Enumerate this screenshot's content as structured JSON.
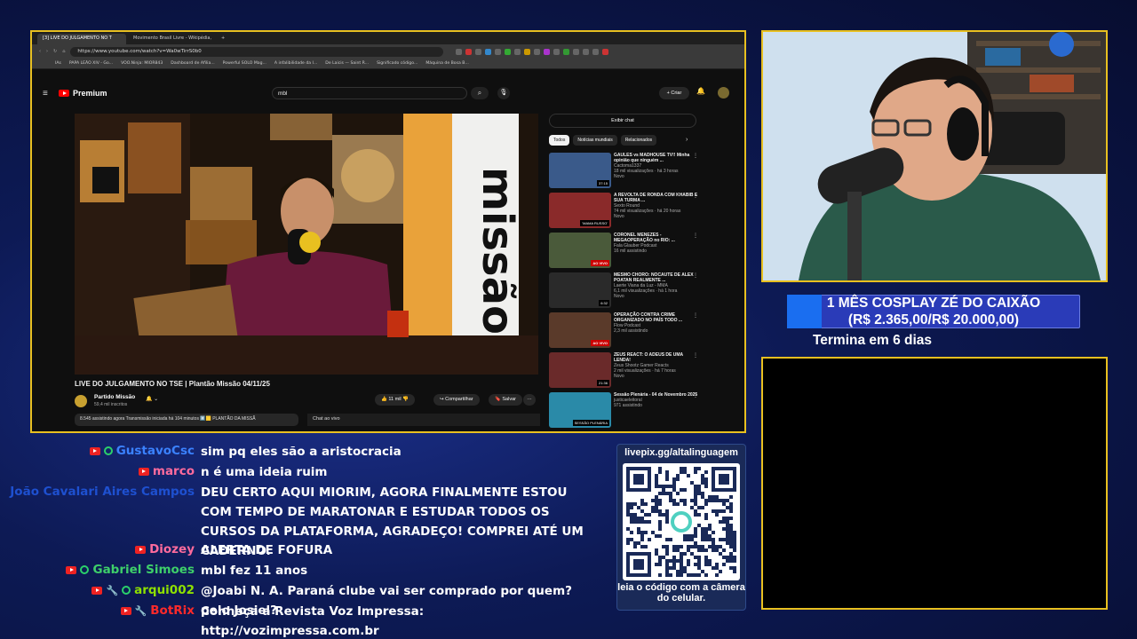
{
  "browser": {
    "tabs": [
      "[3] LIVE DO JULGAMENTO NO T",
      "Movimento Brasil Livre - Wikipédia,"
    ],
    "tab_add": "+",
    "url": "https://www.youtube.com/watch?v=Wa0wTirrS0b0",
    "bookmarks": [
      "IAs",
      "PAPA LEÃO XIV - Go...",
      "VOO.Ninja: MIOR843",
      "Dashboard de Afilia...",
      "Powerful SOLO Mag...",
      "A infalibilidade da I...",
      "De Laicis — Saint R...",
      "Significado código...",
      "Máquina de Bosa B..."
    ]
  },
  "youtube": {
    "logo": "Premium",
    "search_value": "mbl",
    "create": "+ Criar",
    "video_title": "LIVE DO JULGAMENTO NO TSE | Plantão Missão 04/11/25",
    "channel": "Partido Missão",
    "subscribers": "59,4 mil inscritos",
    "likes": "11 mil",
    "share": "Compartilhar",
    "save": "Salvar",
    "more": "···",
    "description": "8.545 assistindo agora  Transmissão iniciada há 104 minutos  #️⃣🟨 PLANTÃO DA MISSÃ",
    "chat_label": "Chat ao vivo",
    "show_chat": "Exibir chat",
    "chips": [
      "Todos",
      "Notícias mundiais",
      "Relacionados"
    ],
    "recommendations": [
      {
        "title": "GAULES vs MADHOUSE TV!! Minha opinião que ninguém ...",
        "channel": "Cactoma1337",
        "meta": "18 mil visualizações · há 3 horas",
        "badge": "Novo",
        "overlay": "37:15",
        "color": "#3a5a8a"
      },
      {
        "title": "A REVOLTA DE RONDA COM KHABIB E SUA TURMA ...",
        "channel": "Sexto Round",
        "meta": "74 mil visualizações · há 20 horas",
        "badge": "Novo",
        "overlay": "'MAMA RUSSO'",
        "color": "#8a2a2a"
      },
      {
        "title": "CORONEL MENEZES - MEGAOPERAÇÃO no RIO: ...",
        "channel": "Fala Glauber Podcast",
        "meta": "16 mil assistindo",
        "badge": "",
        "overlay": "AO VIVO",
        "color": "#4a5a3a"
      },
      {
        "title": "MESMO CHORO: NOCAUTE DE ALEX POATAN REALMENTE ...",
        "channel": "Laerte Viana da Luz - MMA",
        "meta": "6,1 mil visualizações · há 1 hora",
        "badge": "Novo",
        "overlay": "6:32",
        "color": "#2a2a2a"
      },
      {
        "title": "OPERAÇÃO CONTRA CRIME ORGANIZADO NO PAÍS TODO ...",
        "channel": "Flow Podcast",
        "meta": "2,3 mil assistindo",
        "badge": "",
        "overlay": "AO VIVO",
        "color": "#5a3a2a"
      },
      {
        "title": "ZEUS REACT: O ADEUS DE UMA LENDA!",
        "channel": "Zeus Shootz Gamer Reacts",
        "meta": "2 mil visualizações · há 7 horas",
        "badge": "Novo",
        "overlay": "21:36",
        "color": "#6a2a2a"
      },
      {
        "title": "Sessão Plenária - 04 de Novembro 2025",
        "channel": "justicaeleitoral",
        "meta": "971 assistindo",
        "badge": "",
        "overlay": "SESSÃO PLENÁRIA",
        "color": "#2a8aa8"
      }
    ]
  },
  "goal": {
    "line1": "1 MÊS COSPLAY ZÉ DO CAIXÃO",
    "line2": "(R$ 2.365,00/R$ 20.000,00)",
    "ends": "Termina em 6 dias",
    "progress": 0.118
  },
  "chat": [
    {
      "name": "GustavoCsc",
      "color": "#3b82ff",
      "badges": [
        "yt",
        "green"
      ],
      "message": "sim pq eles são a aristocracia"
    },
    {
      "name": "marco",
      "color": "#ff6b9d",
      "badges": [
        "yt"
      ],
      "message": "n é uma ideia ruim"
    },
    {
      "name": "João Cavalari Aires Campos",
      "color": "#1e50d0",
      "badges": [],
      "message": "DEU CERTO AQUI MIORIM, AGORA FINALMENTE ESTOU COM TEMPO DE MARATONAR E ESTUDAR TODOS OS CURSOS DA PLATAFORMA, AGRADEÇO! COMPREI ATÉ UM CADERNO."
    },
    {
      "name": "Diozey",
      "color": "#ff6b9d",
      "badges": [
        "yt"
      ],
      "message": "ALERTA DE FOFURA"
    },
    {
      "name": "Gabriel Simoes",
      "color": "#3ecf6a",
      "badges": [
        "yt",
        "green"
      ],
      "message": "mbl fez 11 anos"
    },
    {
      "name": "arqui002",
      "color": "#8ee000",
      "badges": [
        "yt",
        "wrench",
        "green"
      ],
      "message": "@Joabi N. A. Paraná clube vai ser comprado por quem? pelo Josiel?"
    },
    {
      "name": "BotRix",
      "color": "#ff2a2a",
      "badges": [
        "yt",
        "wrench"
      ],
      "message": "Conheça a Revista Voz Impressa: http://vozimpressa.com.br"
    }
  ],
  "qr": {
    "title": "livepix.gg/altalinguagem",
    "caption": "leia o código com a câmera do celular."
  }
}
